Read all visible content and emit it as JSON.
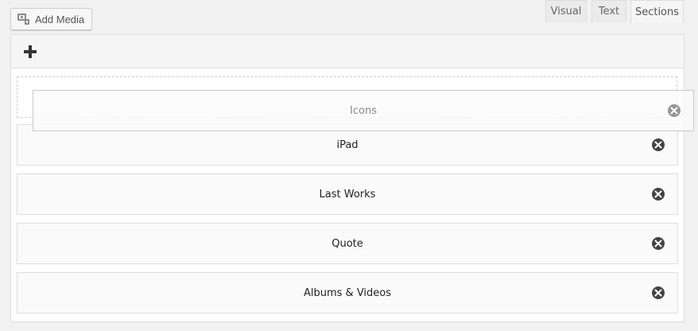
{
  "toolbar": {
    "add_media_label": "Add Media",
    "add_media_icon": "media-camera-icon",
    "add_section_icon": "plus-icon"
  },
  "tabs": [
    {
      "label": "Visual",
      "active": false
    },
    {
      "label": "Text",
      "active": false
    },
    {
      "label": "Sections",
      "active": true
    }
  ],
  "dragging_section": {
    "label": "Icons",
    "remove_icon": "close-circle-icon"
  },
  "sections": [
    {
      "label": "iPad",
      "remove_icon": "close-circle-icon"
    },
    {
      "label": "Last Works",
      "remove_icon": "close-circle-icon"
    },
    {
      "label": "Quote",
      "remove_icon": "close-circle-icon"
    },
    {
      "label": "Albums & Videos",
      "remove_icon": "close-circle-icon"
    }
  ],
  "colors": {
    "background": "#f1f1f1",
    "panel": "#ffffff",
    "toolbar": "#f5f5f5",
    "border": "#dddddd",
    "text": "#222222"
  }
}
